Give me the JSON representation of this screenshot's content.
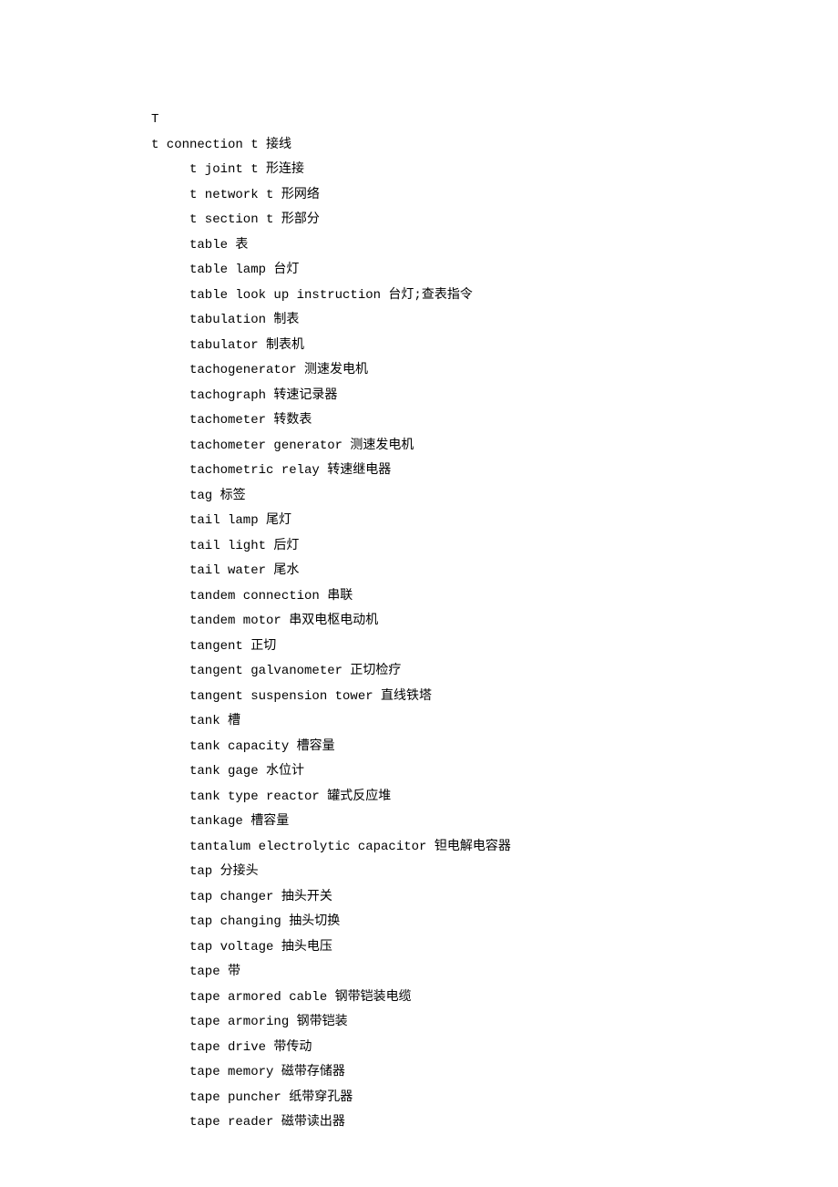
{
  "header": "T",
  "subheader": "t connection t 接线",
  "entries": [
    "t joint t 形连接",
    "t network t 形网络",
    "t section t 形部分",
    "table 表",
    "table lamp 台灯",
    "table look up instruction 台灯;查表指令",
    "tabulation 制表",
    "tabulator 制表机",
    "tachogenerator 测速发电机",
    "tachograph 转速记录器",
    "tachometer 转数表",
    "tachometer generator 测速发电机",
    "tachometric relay 转速继电器",
    "tag 标签",
    "tail lamp 尾灯",
    "tail light 后灯",
    "tail water 尾水",
    "tandem connection 串联",
    "tandem motor 串双电枢电动机",
    "tangent 正切",
    "tangent galvanometer 正切检疗",
    "tangent suspension tower 直线铁塔",
    "tank 槽",
    "tank capacity 槽容量",
    "tank gage 水位计",
    "tank type reactor 罐式反应堆",
    "tankage 槽容量",
    "tantalum electrolytic capacitor 钽电解电容器",
    "tap 分接头",
    "tap changer 抽头开关",
    "tap changing 抽头切换",
    "tap voltage 抽头电压",
    "tape 带",
    "tape armored cable 钢带铠装电缆",
    "tape armoring 钢带铠装",
    "tape drive 带传动",
    "tape memory 磁带存储器",
    "tape puncher 纸带穿孔器",
    "tape reader 磁带读出器"
  ]
}
